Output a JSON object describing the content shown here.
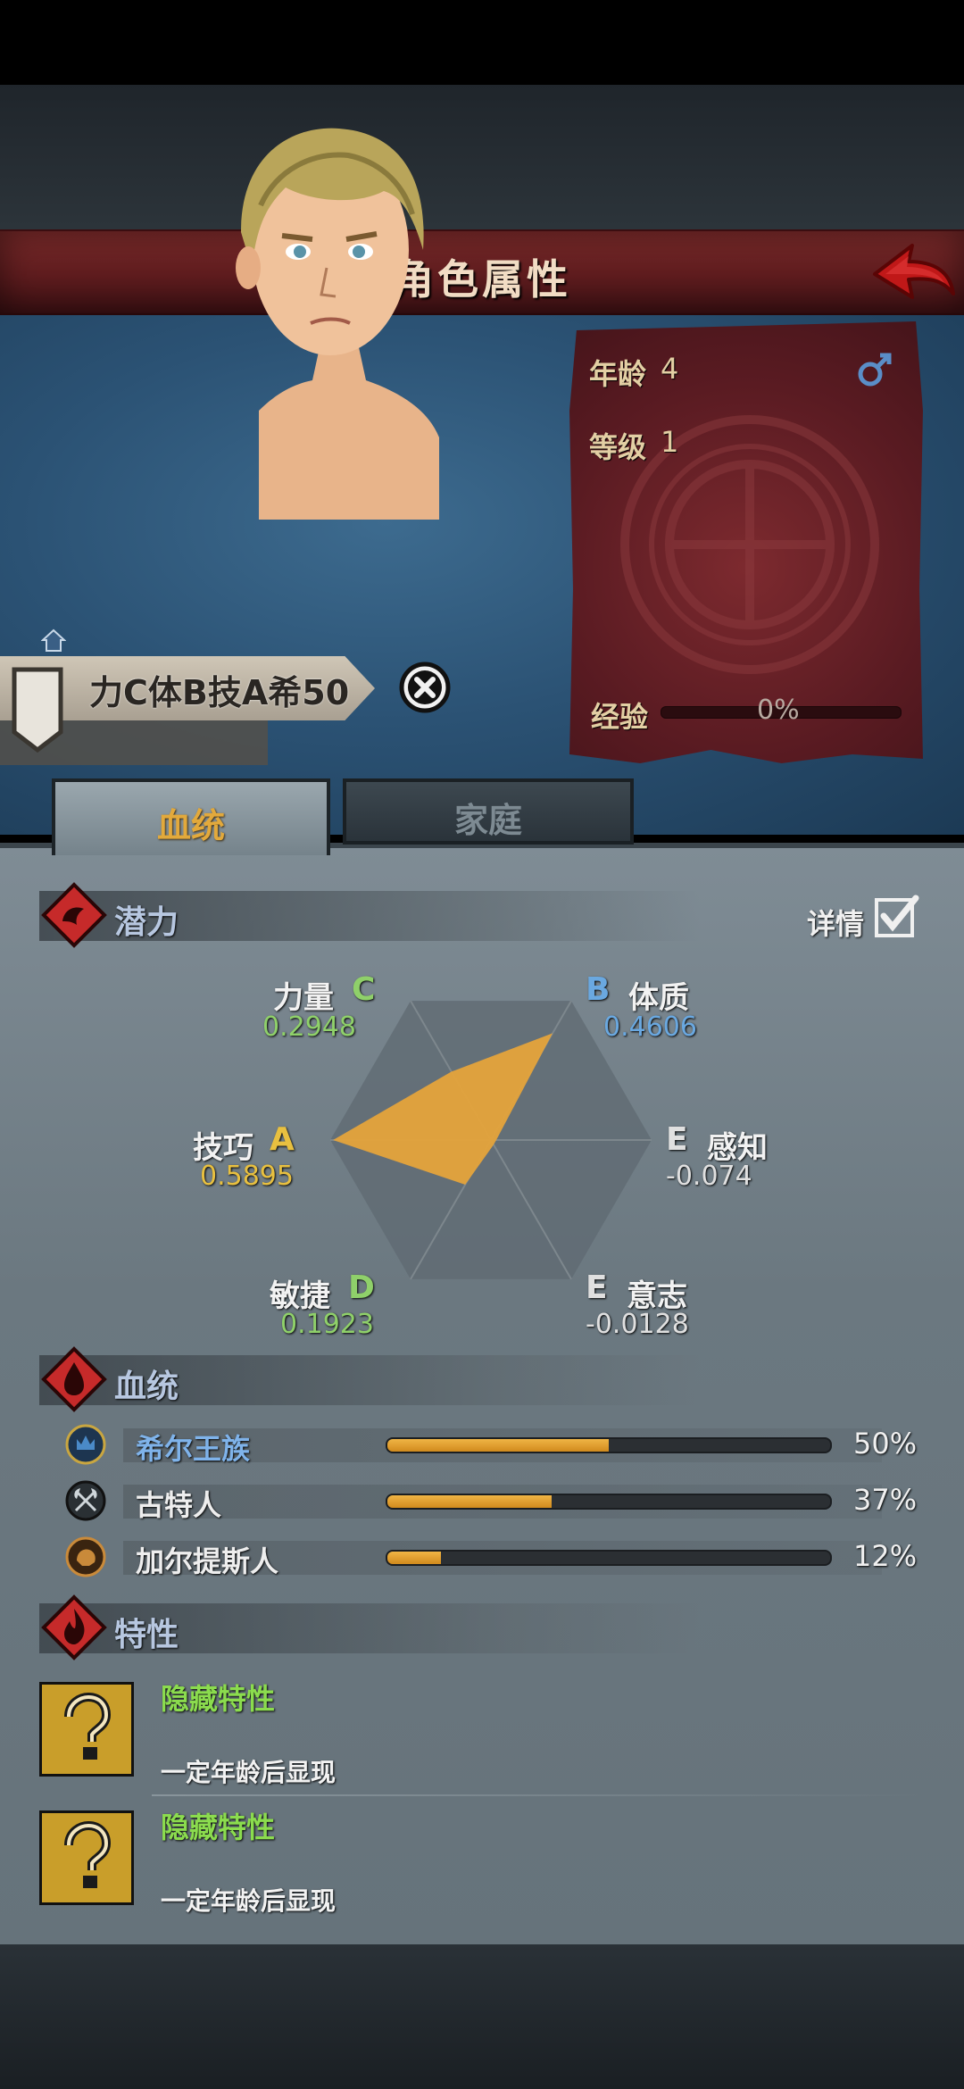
{
  "colors": {
    "accent_orange": "#e5a33b",
    "title_red": "#6e2326",
    "grade_C": "#8fd06a",
    "grade_B": "#6aa8e0",
    "grade_A": "#e8c040",
    "grade_D": "#8fd06a",
    "grade_E": "#e0e0e0",
    "trait_green": "#8bdc4e"
  },
  "header": {
    "title": "角色属性"
  },
  "character": {
    "name": "力C体B技A希50",
    "age_label": "年龄",
    "age": "4",
    "level_label": "等级",
    "level": "1",
    "exp_label": "经验",
    "exp_percent": "0%",
    "gender": "male"
  },
  "tabs": {
    "bloodline": "血统",
    "family": "家庭"
  },
  "potential": {
    "section_title": "潜力",
    "detail_label": "详情",
    "detail_checked": true,
    "stats": {
      "strength": {
        "name": "力量",
        "grade": "C",
        "value": "0.2948"
      },
      "constitution": {
        "name": "体质",
        "grade": "B",
        "value": "0.4606"
      },
      "skill": {
        "name": "技巧",
        "grade": "A",
        "value": "0.5895"
      },
      "perception": {
        "name": "感知",
        "grade": "E",
        "value": "-0.074"
      },
      "agility": {
        "name": "敏捷",
        "grade": "D",
        "value": "0.1923"
      },
      "willpower": {
        "name": "意志",
        "grade": "E",
        "value": "-0.0128"
      }
    }
  },
  "bloodline": {
    "section_title": "血统",
    "items": [
      {
        "name": "希尔王族",
        "percent": "50%",
        "fraction": 0.5,
        "icon": "royal-crest-icon",
        "name_color": "#7fb3ea"
      },
      {
        "name": "古特人",
        "percent": "37%",
        "fraction": 0.37,
        "icon": "crossed-axes-icon",
        "name_color": "#eeeeee"
      },
      {
        "name": "加尔提斯人",
        "percent": "12%",
        "fraction": 0.12,
        "icon": "boar-crest-icon",
        "name_color": "#eeeeee"
      }
    ]
  },
  "traits": {
    "section_title": "特性",
    "items": [
      {
        "name": "隐藏特性",
        "desc": "一定年龄后显现",
        "icon": "question-mark-icon"
      },
      {
        "name": "隐藏特性",
        "desc": "一定年龄后显现",
        "icon": "question-mark-icon"
      }
    ]
  }
}
